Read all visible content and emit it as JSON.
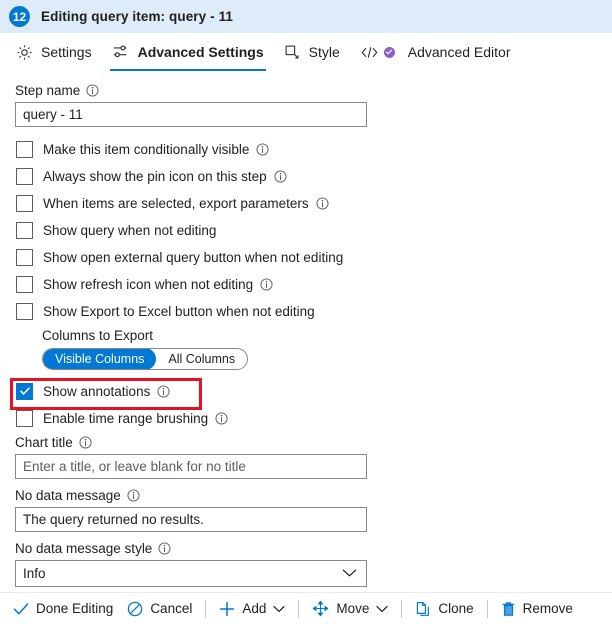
{
  "header": {
    "step_number": "12",
    "title": "Editing query item: query - 11",
    "badge_color": "#0078d4",
    "banner_color": "#deecf9"
  },
  "tabs": [
    {
      "label": "Settings",
      "icon": "gear-icon",
      "active": false
    },
    {
      "label": "Advanced Settings",
      "icon": "sliders-icon",
      "active": true
    },
    {
      "label": "Style",
      "icon": "style-corner-icon",
      "active": false
    },
    {
      "label": "Advanced Editor",
      "icon": "code-icon",
      "active": false,
      "badge": "preview-dot"
    }
  ],
  "form": {
    "step_name": {
      "label": "Step name",
      "value": "query - 11",
      "has_info": true
    },
    "checkboxes": [
      {
        "label": "Make this item conditionally visible",
        "checked": false,
        "has_info": true
      },
      {
        "label": "Always show the pin icon on this step",
        "checked": false,
        "has_info": true
      },
      {
        "label": "When items are selected, export parameters",
        "checked": false,
        "has_info": true
      },
      {
        "label": "Show query when not editing",
        "checked": false,
        "has_info": false
      },
      {
        "label": "Show open external query button when not editing",
        "checked": false,
        "has_info": false
      },
      {
        "label": "Show refresh icon when not editing",
        "checked": false,
        "has_info": true
      },
      {
        "label": "Show Export to Excel button when not editing",
        "checked": false,
        "has_info": false
      }
    ],
    "columns_to_export": {
      "label": "Columns to Export",
      "options": [
        "Visible Columns",
        "All Columns"
      ],
      "selected": "Visible Columns",
      "selected_color": "#0078d4"
    },
    "show_annotations": {
      "label": "Show annotations",
      "checked": true,
      "has_info": true,
      "highlight_color": "#e81123"
    },
    "time_range_brushing": {
      "label": "Enable time range brushing",
      "checked": false,
      "has_info": true
    },
    "chart_title": {
      "label": "Chart title",
      "value": "",
      "placeholder": "Enter a title, or leave blank for no title",
      "has_info": true
    },
    "no_data_message": {
      "label": "No data message",
      "value": "The query returned no results.",
      "has_info": true
    },
    "no_data_message_style": {
      "label": "No data message style",
      "selected": "Info",
      "has_info": true
    }
  },
  "commandbar": [
    {
      "label": "Done Editing",
      "icon": "checkmark-icon",
      "caret": false
    },
    {
      "label": "Cancel",
      "icon": "block-icon",
      "caret": false
    },
    {
      "label": "Add",
      "icon": "plus-icon",
      "caret": true
    },
    {
      "label": "Move",
      "icon": "move-arrows-icon",
      "caret": true
    },
    {
      "label": "Clone",
      "icon": "copy-icon",
      "caret": false
    },
    {
      "label": "Remove",
      "icon": "trash-icon",
      "caret": false
    }
  ]
}
